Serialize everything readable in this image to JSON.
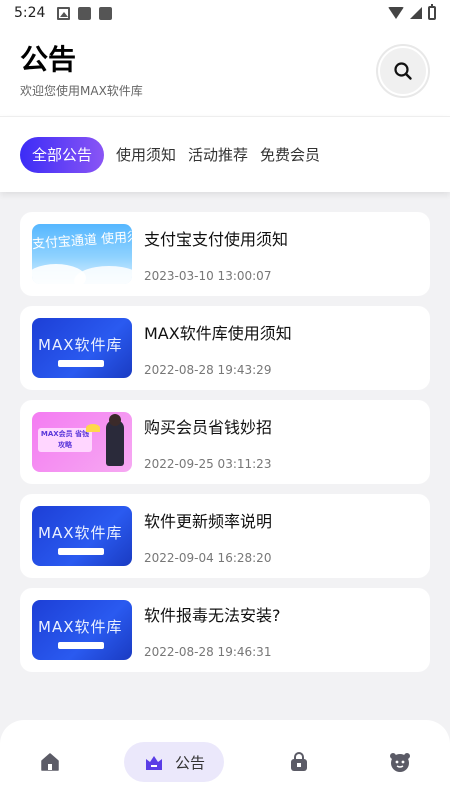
{
  "status_bar": {
    "time": "5:24"
  },
  "header": {
    "title": "公告",
    "subtitle": "欢迎您使用MAX软件库"
  },
  "tabs": [
    {
      "label": "全部公告",
      "active": true
    },
    {
      "label": "使用须知",
      "active": false
    },
    {
      "label": "活动推荐",
      "active": false
    },
    {
      "label": "免费会员",
      "active": false
    }
  ],
  "notices": [
    {
      "title": "支付宝支付使用须知",
      "date": "2023-03-10 13:00:07",
      "thumb": "sky",
      "thumb_text": "支付宝通道 使用须知"
    },
    {
      "title": "MAX软件库使用须知",
      "date": "2022-08-28 19:43:29",
      "thumb": "blue",
      "thumb_text": "MAX软件库"
    },
    {
      "title": "购买会员省钱妙招",
      "date": "2022-09-25 03:11:23",
      "thumb": "pink",
      "thumb_text": "MAX会员 省钱攻略"
    },
    {
      "title": "软件更新频率说明",
      "date": "2022-09-04 16:28:20",
      "thumb": "blue",
      "thumb_text": "MAX软件库"
    },
    {
      "title": "软件报毒无法安装?",
      "date": "2022-08-28 19:46:31",
      "thumb": "blue",
      "thumb_text": "MAX软件库"
    }
  ],
  "bottom_nav": {
    "active_label": "公告",
    "items": [
      "home-icon",
      "notice-icon",
      "bag-icon",
      "profile-icon"
    ]
  },
  "colors": {
    "accent_start": "#3c2cf6",
    "accent_end": "#8a55f5",
    "nav_active_bg": "#ebe8fb",
    "nav_icon": "#5b5b66",
    "nav_active_icon": "#5a3de6"
  }
}
